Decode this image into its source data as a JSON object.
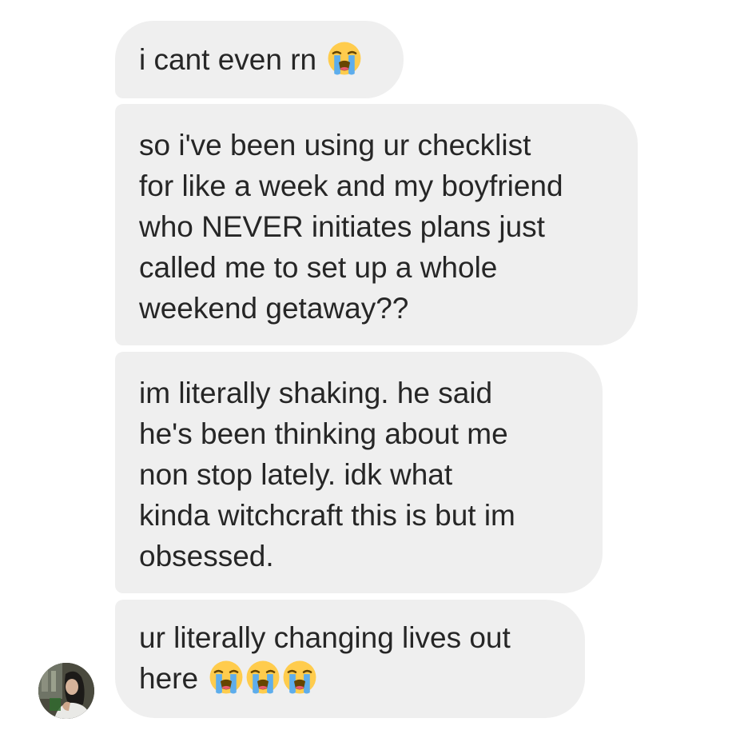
{
  "messages": [
    {
      "lines": [
        "i cant even rn"
      ],
      "emoji_count": 1,
      "emoji": "loudly-crying-face-icon"
    },
    {
      "lines": [
        "so i've been using ur checklist",
        "for like a week and my boyfriend",
        "who NEVER initiates plans just",
        "called me to set up a whole",
        "weekend getaway??"
      ],
      "emoji_count": 0
    },
    {
      "lines": [
        "im literally shaking. he said",
        "he's been thinking about me",
        "non stop lately. idk what",
        "kinda witchcraft this is but im",
        "obsessed."
      ],
      "emoji_count": 0
    },
    {
      "lines": [
        "ur literally changing lives out",
        "here"
      ],
      "emoji_count": 3,
      "emoji": "loudly-crying-face-icon"
    }
  ],
  "sender": {
    "avatar_icon": "profile-photo-avatar"
  },
  "colors": {
    "bubble_background": "#efefef",
    "text": "#262626",
    "page_background": "#ffffff"
  }
}
